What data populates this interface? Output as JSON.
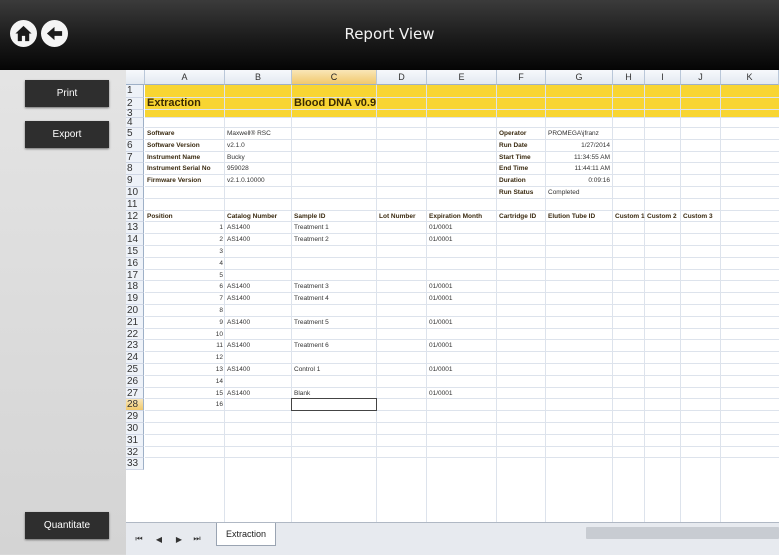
{
  "window": {
    "title": "Report View"
  },
  "side_buttons": {
    "print": "Print",
    "export": "Export",
    "quantitate": "Quantitate"
  },
  "sheet": {
    "columns": [
      "A",
      "B",
      "C",
      "D",
      "E",
      "F",
      "G",
      "H",
      "I",
      "J",
      "K"
    ],
    "selected_column": "C",
    "rows": [
      "1",
      "2",
      "3",
      "4",
      "5",
      "6",
      "7",
      "8",
      "9",
      "10",
      "11",
      "12",
      "13",
      "14",
      "15",
      "16",
      "17",
      "18",
      "19",
      "20",
      "21",
      "22",
      "23",
      "24",
      "25",
      "26",
      "27",
      "28",
      "29",
      "30",
      "31",
      "32",
      "33"
    ],
    "selected_row": "28",
    "header": {
      "title": "Extraction",
      "method": "Blood DNA v0.9",
      "band_color": "#f8d532"
    },
    "info_left": [
      {
        "label": "Software",
        "value": "Maxwell® RSC"
      },
      {
        "label": "Software Version",
        "value": "v2.1.0"
      },
      {
        "label": "Instrument Name",
        "value": "Bucky"
      },
      {
        "label": "Instrument Serial No",
        "value": "959028"
      },
      {
        "label": "Firmware Version",
        "value": "v2.1.0.10000"
      }
    ],
    "info_right": [
      {
        "label": "Operator",
        "value": "PROMEGA\\jfranz"
      },
      {
        "label": "Run Date",
        "value": "1/27/2014"
      },
      {
        "label": "Start Time",
        "value": "11:34:55 AM"
      },
      {
        "label": "End Time",
        "value": "11:44:11 AM"
      },
      {
        "label": "Duration",
        "value": "0:09:16"
      },
      {
        "label": "Run Status",
        "value": "Completed"
      }
    ],
    "table_headers": [
      "Position",
      "Catalog Number",
      "Sample ID",
      "Lot Number",
      "Expiration Month",
      "Cartridge ID",
      "Elution Tube ID",
      "Custom 1",
      "Custom 2",
      "Custom 3"
    ],
    "table_rows": [
      {
        "pos": "1",
        "catalog": "AS1400",
        "sample": "Treatment 1",
        "exp": "01/0001"
      },
      {
        "pos": "2",
        "catalog": "AS1400",
        "sample": "Treatment 2",
        "exp": "01/0001"
      },
      {
        "pos": "3",
        "catalog": "",
        "sample": "",
        "exp": ""
      },
      {
        "pos": "4",
        "catalog": "",
        "sample": "",
        "exp": ""
      },
      {
        "pos": "5",
        "catalog": "",
        "sample": "",
        "exp": ""
      },
      {
        "pos": "6",
        "catalog": "AS1400",
        "sample": "Treatment 3",
        "exp": "01/0001"
      },
      {
        "pos": "7",
        "catalog": "AS1400",
        "sample": "Treatment 4",
        "exp": "01/0001"
      },
      {
        "pos": "8",
        "catalog": "",
        "sample": "",
        "exp": ""
      },
      {
        "pos": "9",
        "catalog": "AS1400",
        "sample": "Treatment 5",
        "exp": "01/0001"
      },
      {
        "pos": "10",
        "catalog": "",
        "sample": "",
        "exp": ""
      },
      {
        "pos": "11",
        "catalog": "AS1400",
        "sample": "Treatment 6",
        "exp": "01/0001"
      },
      {
        "pos": "12",
        "catalog": "",
        "sample": "",
        "exp": ""
      },
      {
        "pos": "13",
        "catalog": "AS1400",
        "sample": "Control 1",
        "exp": "01/0001"
      },
      {
        "pos": "14",
        "catalog": "",
        "sample": "",
        "exp": ""
      },
      {
        "pos": "15",
        "catalog": "AS1400",
        "sample": "Blank",
        "exp": "01/0001"
      },
      {
        "pos": "16",
        "catalog": "",
        "sample": "",
        "exp": ""
      }
    ]
  },
  "tabs": {
    "active": "Extraction"
  },
  "icons": {
    "home": "home-icon",
    "back": "back-arrow-icon"
  }
}
